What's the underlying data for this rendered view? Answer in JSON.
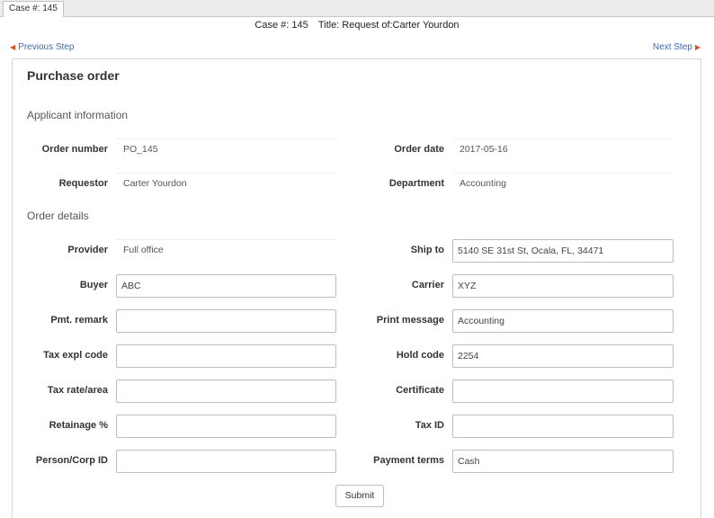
{
  "tab": {
    "label": "Case #: 145"
  },
  "header": {
    "case": "Case #: 145",
    "title": "Title: Request of:Carter Yourdon"
  },
  "nav": {
    "previous": "Previous Step",
    "next": "Next Step"
  },
  "form": {
    "title": "Purchase order",
    "section_applicant": "Applicant information",
    "section_order": "Order details",
    "applicant": [
      {
        "label": "Order number",
        "value": "PO_145"
      },
      {
        "label": "Order date",
        "value": "2017-05-16"
      },
      {
        "label": "Requestor",
        "value": "Carter Yourdon"
      },
      {
        "label": "Department",
        "value": "Accounting"
      }
    ],
    "provider": {
      "label": "Provider",
      "value": "Full office"
    },
    "ship_to": {
      "label": "Ship to",
      "value": "5140 SE 31st St, Ocala, FL, 34471"
    },
    "buyer": {
      "label": "Buyer",
      "value": "ABC"
    },
    "carrier": {
      "label": "Carrier",
      "value": "XYZ"
    },
    "pmt_remark": {
      "label": "Pmt. remark",
      "value": ""
    },
    "print_message": {
      "label": "Print message",
      "value": "Accounting"
    },
    "tax_expl_code": {
      "label": "Tax expl code",
      "value": ""
    },
    "hold_code": {
      "label": "Hold code",
      "value": "2254"
    },
    "tax_rate_area": {
      "label": "Tax rate/area",
      "value": ""
    },
    "certificate": {
      "label": "Certificate",
      "value": ""
    },
    "retainage": {
      "label": "Retainage %",
      "value": ""
    },
    "tax_id": {
      "label": "Tax ID",
      "value": ""
    },
    "person_corp_id": {
      "label": "Person/Corp ID",
      "value": ""
    },
    "payment_terms": {
      "label": "Payment terms",
      "value": "Cash"
    },
    "submit": "Submit"
  }
}
